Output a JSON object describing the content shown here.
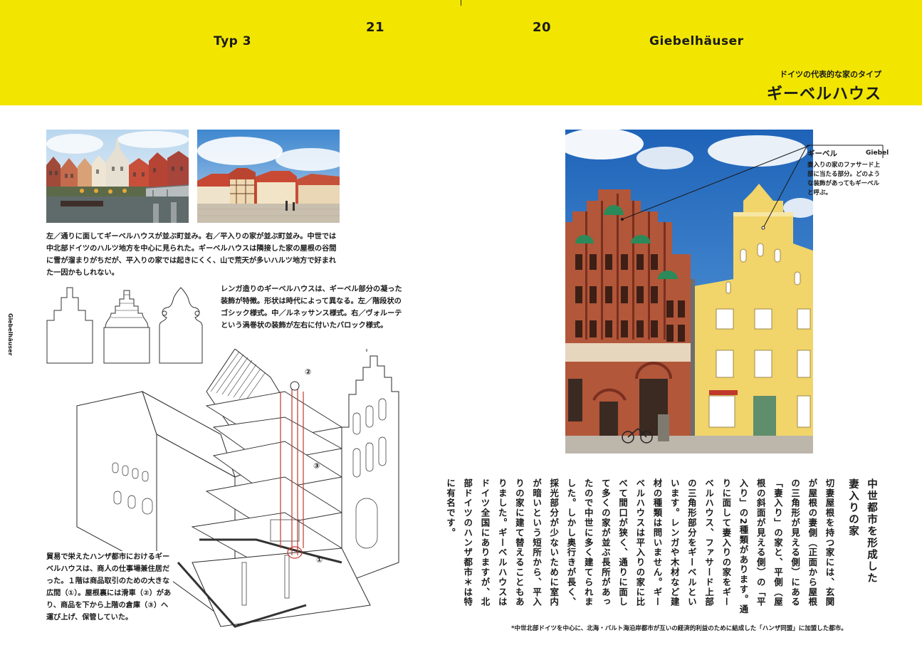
{
  "header": {
    "left_label": "Typ 3",
    "page_left": "21",
    "page_right": "20",
    "right_label": "Giebelhäuser",
    "subtitle": "ドイツの代表的な家のタイプ",
    "title": "ギーベルハウス"
  },
  "side_tab": {
    "label": "Giebelhäuser"
  },
  "photo_caption": "左／通りに面してギーベルハウスが並ぶ町並み。右／平入りの家が並ぶ町並み。中世では中北部ドイツのハルツ地方を中心に見られた。ギーベルハウスは隣接した家の屋根の谷間に雪が溜まりがちだが、平入りの家では起きにくく、山で荒天が多いハルツ地方で好まれた一因かもしれない。",
  "gable_caption": "レンガ造りのギーベルハウスは、ギーベル部分の凝った装飾が特徴。形状は時代によって異なる。左／階段状のゴシック様式。中／ルネッサンス様式。右／ヴォルーテという渦巻状の装飾が左右に付いたバロック様式。",
  "illustration": {
    "caption": "貿易で栄えたハンザ都市におけるギーベルハウスは、商人の仕事場兼住居だった。１階は商品取引のための大きな広間（①）。屋根裏には滑車（②）があり、商品を下から上階の倉庫（③）へ運び上げ、保管していた。",
    "marker_1": "①",
    "marker_2": "②",
    "marker_3": "③"
  },
  "giebel_label": {
    "en": "Giebel",
    "jp": "ギーベル",
    "note": "妻入りの家のファサード上部に当たる部分。どのような装飾があってもギーベルと呼ぶ。"
  },
  "article": {
    "heading": "中世都市を形成した妻入りの家",
    "body": "切妻屋根を持つ家には、玄関が屋根の妻側（正面から屋根の三角形が見える側）にある「妻入り」の家と、平側（屋根の斜面が見える側）の「平入り」の2種類があります。通りに面して妻入りの家をギーベルハウス、ファサード上部の三角形部分をギーベルといいます。レンガや木材など建材の種類は問いません。ギーベルハウスは平入りの家に比べて間口が狭く、通りに面して多くの家が並ぶ長所があったので中世に多く建てられました。しかし奥行きが長く、採光部分が少ないために室内が暗いという短所から、平入りの家に建て替えることもありました。ギーベルハウスはドイツ全国にありますが、北部ドイツのハンザ都市＊は特に有名です。"
  },
  "footnote": "*中世北部ドイツを中心に、北海・バルト海沿岸都市が互いの経済的利益のために結成した「ハンザ同盟」に加盟した都市。",
  "colors": {
    "header_yellow": "#f2e600",
    "brick": "#b2573a",
    "yellow_facade": "#f1d46a",
    "sky": "#2c79c8"
  }
}
